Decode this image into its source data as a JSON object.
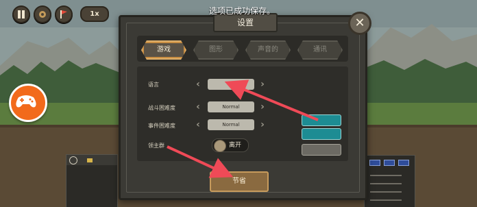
{
  "hud": {
    "speed": "1x",
    "icons": [
      "pause-icon",
      "gear-icon",
      "flag-icon"
    ]
  },
  "toast": "选项已成功保存。",
  "panel": {
    "title": "设置",
    "tabs": [
      {
        "label": "游戏",
        "active": true
      },
      {
        "label": "图形",
        "active": false
      },
      {
        "label": "声音的",
        "active": false
      },
      {
        "label": "通讯",
        "active": false
      }
    ],
    "rows": [
      {
        "label": "语言",
        "value": ""
      },
      {
        "label": "战斗困难度",
        "value": "Normal"
      },
      {
        "label": "事件困难度",
        "value": "Normal"
      },
      {
        "label": "领主群",
        "value": "离开"
      }
    ],
    "side_buttons": [
      "",
      "",
      " "
    ],
    "save_label": "节省"
  },
  "colors": {
    "accent_orange": "#f26a1b",
    "teal_button": "#1d8c93",
    "arrow_red": "#ef4a57",
    "tab_active_border": "#e0b16b"
  }
}
